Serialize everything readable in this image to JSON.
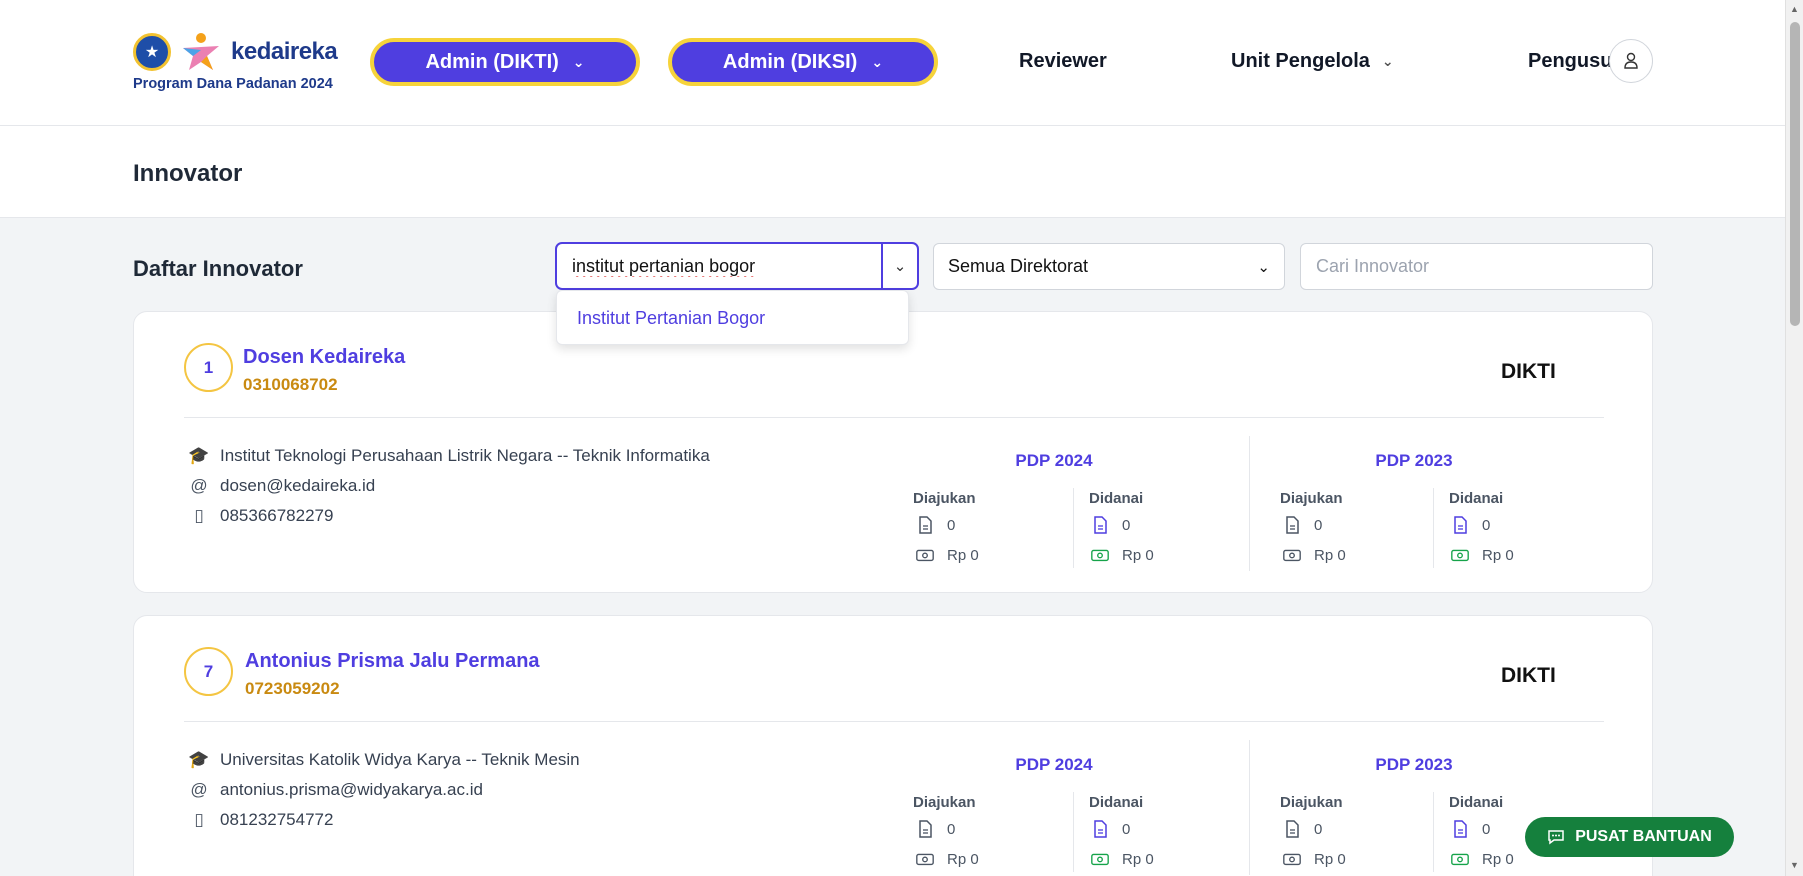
{
  "header": {
    "logo_text": "kedaireka",
    "logo_subtitle": "Program Dana Padanan 2024",
    "admin_dikti": "Admin (DIKTI)",
    "admin_diksi": "Admin (DIKSI)",
    "reviewer": "Reviewer",
    "unit_pengelola": "Unit Pengelola",
    "pengusul": "Pengusul"
  },
  "page_title": "Innovator",
  "section_title": "Daftar Innovator",
  "filters": {
    "institution_value": "institut pertanian bogor",
    "directorate_value": "Semua Direktorat",
    "search_placeholder": "Cari Innovator"
  },
  "dropdown": {
    "options": [
      "Institut Pertanian Bogor"
    ]
  },
  "labels": {
    "submitted": "Diajukan",
    "funded": "Didanai"
  },
  "innovators": [
    {
      "number": "1",
      "name": "Dosen Kedaireka",
      "nidn": "0310068702",
      "directorate": "DIKTI",
      "institution": "Institut Teknologi Perusahaan Listrik Negara -- Teknik Informatika",
      "email": "dosen@kedaireka.id",
      "phone": "085366782279",
      "pdp": [
        {
          "title": "PDP 2024",
          "submitted_count": "0",
          "submitted_amount": "Rp 0",
          "funded_count": "0",
          "funded_amount": "Rp 0"
        },
        {
          "title": "PDP 2023",
          "submitted_count": "0",
          "submitted_amount": "Rp 0",
          "funded_count": "0",
          "funded_amount": "Rp 0"
        }
      ]
    },
    {
      "number": "7",
      "name": "Antonius Prisma Jalu Permana",
      "nidn": "0723059202",
      "directorate": "DIKTI",
      "institution": "Universitas Katolik Widya Karya -- Teknik Mesin",
      "email": "antonius.prisma@widyakarya.ac.id",
      "phone": "081232754772",
      "pdp": [
        {
          "title": "PDP 2024",
          "submitted_count": "0",
          "submitted_amount": "Rp 0",
          "funded_count": "0",
          "funded_amount": "Rp 0"
        },
        {
          "title": "PDP 2023",
          "submitted_count": "0",
          "submitted_amount": "Rp 0",
          "funded_count": "0",
          "funded_amount": "Rp 0"
        }
      ]
    }
  ],
  "help_button": "PUSAT BANTUAN",
  "colors": {
    "primary": "#4f3ee0",
    "accent_yellow": "#f6d33b",
    "nidn_gold": "#c98a11",
    "success_green": "#15803d"
  }
}
